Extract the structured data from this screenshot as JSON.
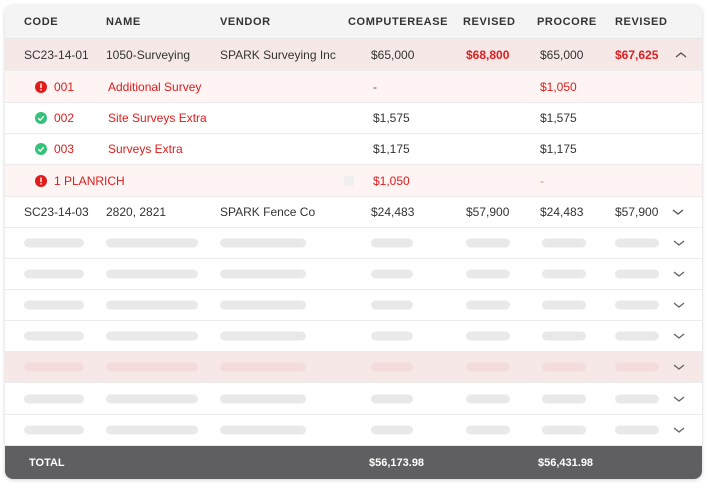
{
  "columns": {
    "code": "CODE",
    "name": "NAME",
    "vendor": "VENDOR",
    "computerease": "COMPUTEREASE",
    "revised1": "REVISED",
    "procore": "PROCORE",
    "revised2": "REVISED"
  },
  "group1": {
    "code": "SC23-14-01",
    "name": "1050-Surveying",
    "vendor": "SPARK Surveying Inc",
    "computerease": "$65,000",
    "revised1": "$68,800",
    "procore": "$65,000",
    "revised2": "$67,625",
    "expand_icon": "chevron-up-icon",
    "items": [
      {
        "status": "error",
        "code": "001",
        "name": "Additional Survey",
        "computerease": "-",
        "procore": "$1,050"
      },
      {
        "status": "ok",
        "code": "002",
        "name": "Site Surveys Extra",
        "computerease": "$1,575",
        "procore": "$1,575"
      },
      {
        "status": "ok",
        "code": "003",
        "name": "Surveys Extra",
        "computerease": "$1,175",
        "procore": "$1,175"
      },
      {
        "status": "error",
        "code": "1 PLANRICH",
        "name": "",
        "computerease": "$1,050",
        "procore": "-"
      }
    ]
  },
  "group2": {
    "code": "SC23-14-03",
    "name": "2820, 2821",
    "vendor": "SPARK Fence Co",
    "computerease": "$24,483",
    "revised1": "$57,900",
    "procore": "$24,483",
    "revised2": "$57,900",
    "expand_icon": "chevron-down-icon"
  },
  "placeholder_rows": 7,
  "highlighted_placeholder_row": 4,
  "footer": {
    "label": "TOTAL",
    "computerease_total": "$56,173.98",
    "procore_total": "$56,431.98"
  },
  "colors": {
    "error": "#e01c1c",
    "ok": "#34c27a",
    "highlight_row": "#f7e8e8",
    "sub_row_error": "#fdf4f3",
    "footer": "#5f5f61"
  }
}
